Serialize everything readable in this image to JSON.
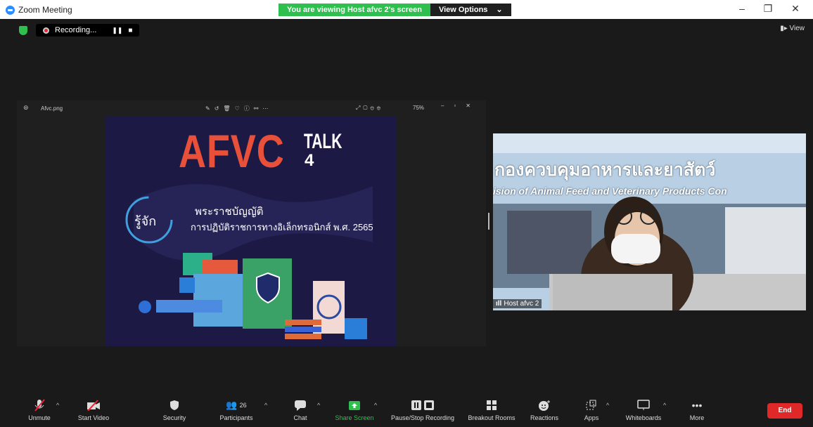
{
  "window": {
    "title": "Zoom Meeting",
    "minimize": "–",
    "restore": "❐",
    "close": "✕"
  },
  "banner": {
    "viewing": "You are viewing Host afvc 2's screen",
    "view_options": "View Options",
    "caret": "⌄"
  },
  "recording": {
    "label": "Recording...",
    "pause": "❚❚",
    "stop": "■"
  },
  "view_button": "View",
  "shared": {
    "filename": "Afvc.png",
    "zoom_level": "75%",
    "slide": {
      "brand": "AFVC",
      "talk": "TALK",
      "number": "4",
      "badge": "รู้จัก",
      "line1": "พระราชบัญญัติ",
      "line2": "การปฏิบัติราชการทางอิเล็กทรอนิกส์ พ.ศ. 2565"
    }
  },
  "video": {
    "sign_thai": "กองควบคุมอาหารและยาสัตว์",
    "sign_en": "ision of Animal Feed and Veterinary Products Con",
    "participant": "Host afvc 2"
  },
  "toolbar": {
    "unmute": "Unmute",
    "start_video": "Start Video",
    "security": "Security",
    "participants": "Participants",
    "participants_count": "26",
    "chat": "Chat",
    "share_screen": "Share Screen",
    "pause_stop": "Pause/Stop Recording",
    "breakout": "Breakout Rooms",
    "reactions": "Reactions",
    "apps": "Apps",
    "whiteboards": "Whiteboards",
    "more": "More",
    "end": "End"
  },
  "colors": {
    "accent": "#2fbf4f",
    "end": "#e02828",
    "slide_title": "#e8503a",
    "slide_bg": "#1a1840"
  }
}
